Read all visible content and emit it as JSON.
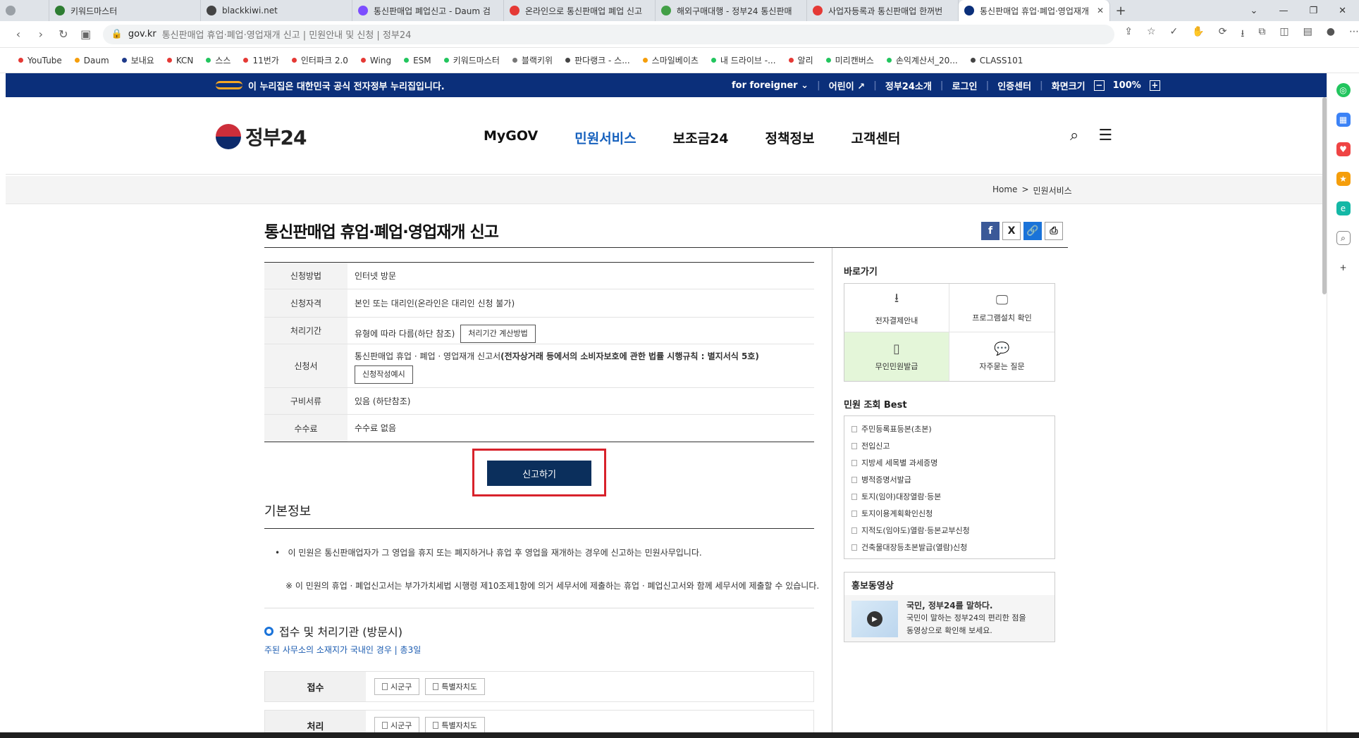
{
  "browser": {
    "tabs": [
      {
        "label": "",
        "color": "#9aa0a6"
      },
      {
        "label": "키워드마스터",
        "color": "#2e7d32"
      },
      {
        "label": "blackkiwi.net",
        "color": "#444444"
      },
      {
        "label": "통신판매업 폐업신고 - Daum 검",
        "color": "#7c4dff"
      },
      {
        "label": "온라인으로 통신판매업 폐업 신고",
        "color": "#e53935"
      },
      {
        "label": "해외구매대행 - 정부24 통신판매",
        "color": "#43a047"
      },
      {
        "label": "사업자등록과 통신판매업 한꺼번",
        "color": "#e53935"
      },
      {
        "label": "통신판매업 휴업·폐업·영업재개",
        "color": "#0b2f7a"
      }
    ],
    "new_tab": "+",
    "url_domain": "gov.kr",
    "url_rest": "통신판매업 휴업·폐업·영업재개 신고 | 민원안내 및 신청 | 정부24",
    "bookmarks": [
      {
        "label": "YouTube",
        "color": "#e53935"
      },
      {
        "label": "Daum",
        "color": "#f59e0b"
      },
      {
        "label": "보내요",
        "color": "#1e3a8a"
      },
      {
        "label": "KCN",
        "color": "#e53935"
      },
      {
        "label": "스스",
        "color": "#22c55e"
      },
      {
        "label": "11번가",
        "color": "#e53935"
      },
      {
        "label": "인터파크 2.0",
        "color": "#e53935"
      },
      {
        "label": "Wing",
        "color": "#e53935"
      },
      {
        "label": "ESM",
        "color": "#22c55e"
      },
      {
        "label": "키워드마스터",
        "color": "#22c55e"
      },
      {
        "label": "블랙키위",
        "color": "#777777"
      },
      {
        "label": "판다랭크 - 스...",
        "color": "#444444"
      },
      {
        "label": "스마일베이츠",
        "color": "#f59e0b"
      },
      {
        "label": "내 드라이브 -...",
        "color": "#22c55e"
      },
      {
        "label": "알리",
        "color": "#e53935"
      },
      {
        "label": "미리캔버스",
        "color": "#22c55e"
      },
      {
        "label": "손익계산서_20...",
        "color": "#22c55e"
      },
      {
        "label": "CLASS101",
        "color": "#444444"
      }
    ]
  },
  "govbar": {
    "notice": "이 누리집은 대한민국 공식 전자정부 누리집입니다.",
    "foreigner": "for foreigner",
    "kids": "어린이",
    "about": "정부24소개",
    "login": "로그인",
    "cert": "인증센터",
    "zoom_label": "화면크기",
    "zoom_minus": "−",
    "zoom_value": "100%",
    "zoom_plus": "+"
  },
  "header": {
    "logo": "정부24",
    "nav": [
      "MyGOV",
      "민원서비스",
      "보조금24",
      "정책정보",
      "고객센터"
    ],
    "active_nav": "민원서비스"
  },
  "breadcrumb": {
    "home": "Home",
    "sep": ">",
    "current": "민원서비스"
  },
  "page": {
    "title": "통신판매업 휴업·폐업·영업재개 신고",
    "share": [
      "f",
      "X",
      "🔗",
      "⎙"
    ]
  },
  "info": {
    "rows": [
      {
        "th": "신청방법",
        "td": "인터넷 방문"
      },
      {
        "th": "신청자격",
        "td": "본인 또는 대리인(온라인은 대리인 신청 불가)"
      },
      {
        "th": "처리기간",
        "td": "유형에 따라 다름(하단 참조)",
        "button": "처리기간 계산방법"
      },
      {
        "th": "신청서",
        "td": "통신판매업 휴업 · 폐업 · 영업재개 신고서",
        "td_bold": "(전자상거래 등에서의 소비자보호에 관한 법률 시행규칙 : 별지서식 5호)",
        "button": "신청작성예시"
      },
      {
        "th": "구비서류",
        "td": "있음 (하단참조)"
      },
      {
        "th": "수수료",
        "td": "수수료 없음"
      }
    ]
  },
  "apply_button": "신고하기",
  "basic": {
    "title": "기본정보",
    "desc1": "이 민원은 통신판매업자가 그 영업을 휴지 또는 폐지하거나 휴업 후 영업을 재개하는 경우에 신고하는 민원사무입니다.",
    "desc2": "※ 이 민원의 휴업 · 폐업신고서는 부가가치세법 시행령 제10조제1항에 의거 세무서에 제출하는 휴업 · 폐업신고서와 함께 세무서에 제출할 수 있습니다."
  },
  "process": {
    "title": "접수 및 처리기관 (방문시)",
    "note": "주된 사무소의 소재지가 국내인 경우 | 총3일",
    "rows": [
      {
        "label": "접수",
        "buttons": [
          "시군구",
          "특별자치도"
        ]
      },
      {
        "label": "처리",
        "buttons": [
          "시군구",
          "특별자치도"
        ]
      }
    ]
  },
  "sidebar": {
    "shortcut_title": "바로가기",
    "shortcuts": [
      {
        "label": "전자결제안내",
        "icon": "⭳"
      },
      {
        "label": "프로그램설치 확인",
        "icon": "🖵"
      },
      {
        "label": "무인민원발급",
        "icon": "▯"
      },
      {
        "label": "자주묻는 질문",
        "icon": "💬"
      }
    ],
    "best_title": "민원 조회 Best",
    "best": [
      "주민등록표등본(초본)",
      "전입신고",
      "지방세 세목별 과세증명",
      "병적증명서발급",
      "토지(임야)대장열람·등본",
      "토지이용계획확인신청",
      "지적도(임야도)열람·등본교부신청",
      "건축물대장등초본발급(열람)신청"
    ],
    "promo_title": "홍보동영상",
    "promo_head": "국민, 정부24를 말하다.",
    "promo_line1": "국민이 말하는 정부24의 편리한 점을",
    "promo_line2": "동영상으로 확인해 보세요."
  }
}
